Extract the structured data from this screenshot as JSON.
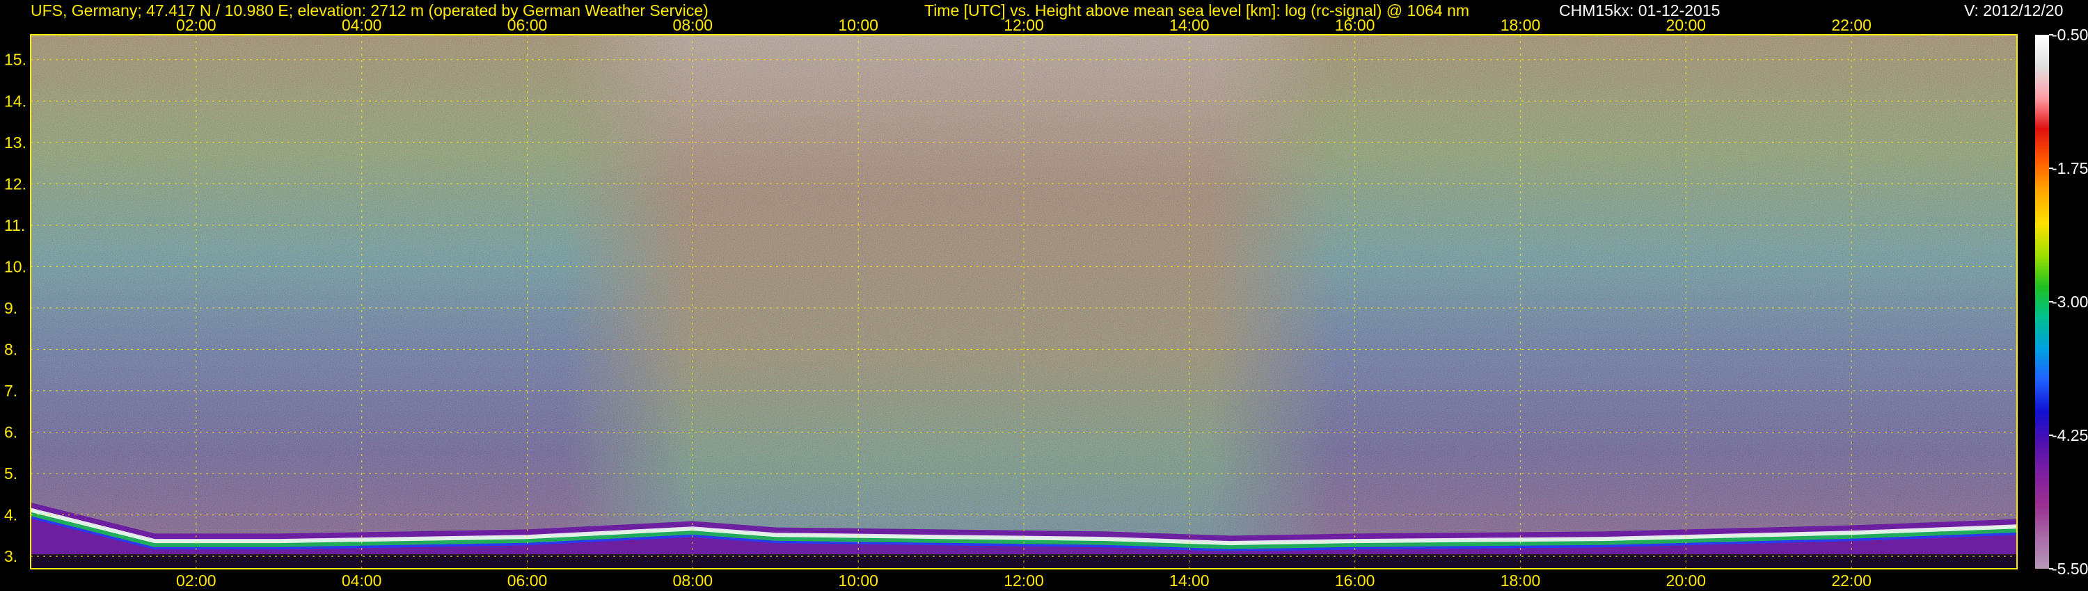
{
  "header": {
    "site": "UFS, Germany; 47.417 N / 10.980 E; elevation: 2712 m  (operated by German Weather Service)",
    "description": "Time [UTC] vs. Height above mean sea level [km]: log (rc-signal) @ 1064 nm",
    "instrument": "CHM15kx: 01-12-2015",
    "version": "V: 2012/12/20"
  },
  "chart_data": {
    "type": "heatmap",
    "title": "Time [UTC] vs. Height above mean sea level [km]: log (rc-signal) @ 1064 nm",
    "xlabel": "Time [UTC]",
    "ylabel": "Height above mean sea level [km]",
    "x_ticks": [
      "02:00",
      "04:00",
      "06:00",
      "08:00",
      "10:00",
      "12:00",
      "14:00",
      "16:00",
      "18:00",
      "20:00",
      "22:00"
    ],
    "x_tick_hours": [
      2,
      4,
      6,
      8,
      10,
      12,
      14,
      16,
      18,
      20,
      22
    ],
    "xlim_hours": [
      0,
      24
    ],
    "y_ticks": [
      "3.",
      "4.",
      "5.",
      "6.",
      "7.",
      "8.",
      "9.",
      "10.",
      "11.",
      "12.",
      "13.",
      "14.",
      "15."
    ],
    "y_tick_values": [
      3,
      4,
      5,
      6,
      7,
      8,
      9,
      10,
      11,
      12,
      13,
      14,
      15
    ],
    "ylim_km": [
      2.7,
      15.6
    ],
    "grid": true,
    "grid_color": "#ffea00",
    "colorbar": {
      "labels": [
        "-0.50",
        "-1.75",
        "-3.00",
        "-4.25",
        "-5.50"
      ],
      "values": [
        -0.5,
        -1.75,
        -3.0,
        -4.25,
        -5.5
      ],
      "colors": [
        "#ffffff",
        "#e0e0e0",
        "#ff9ea8",
        "#e01010",
        "#ff5a00",
        "#ffa800",
        "#ffe000",
        "#a0e000",
        "#20c020",
        "#00c090",
        "#00a0e0",
        "#2060ff",
        "#1010d0",
        "#5010b0",
        "#8020a0",
        "#9a3090",
        "#a86aa8",
        "#b898b8"
      ]
    },
    "boundary_layer": {
      "top_km": [
        4.3,
        3.55,
        3.55,
        3.65,
        3.85,
        3.7,
        3.65,
        3.6,
        3.5,
        3.55,
        3.6,
        3.75,
        3.9
      ],
      "at_hours": [
        0,
        1.5,
        3,
        6,
        8,
        9,
        11,
        13,
        14.5,
        16,
        19,
        22,
        24
      ]
    }
  }
}
